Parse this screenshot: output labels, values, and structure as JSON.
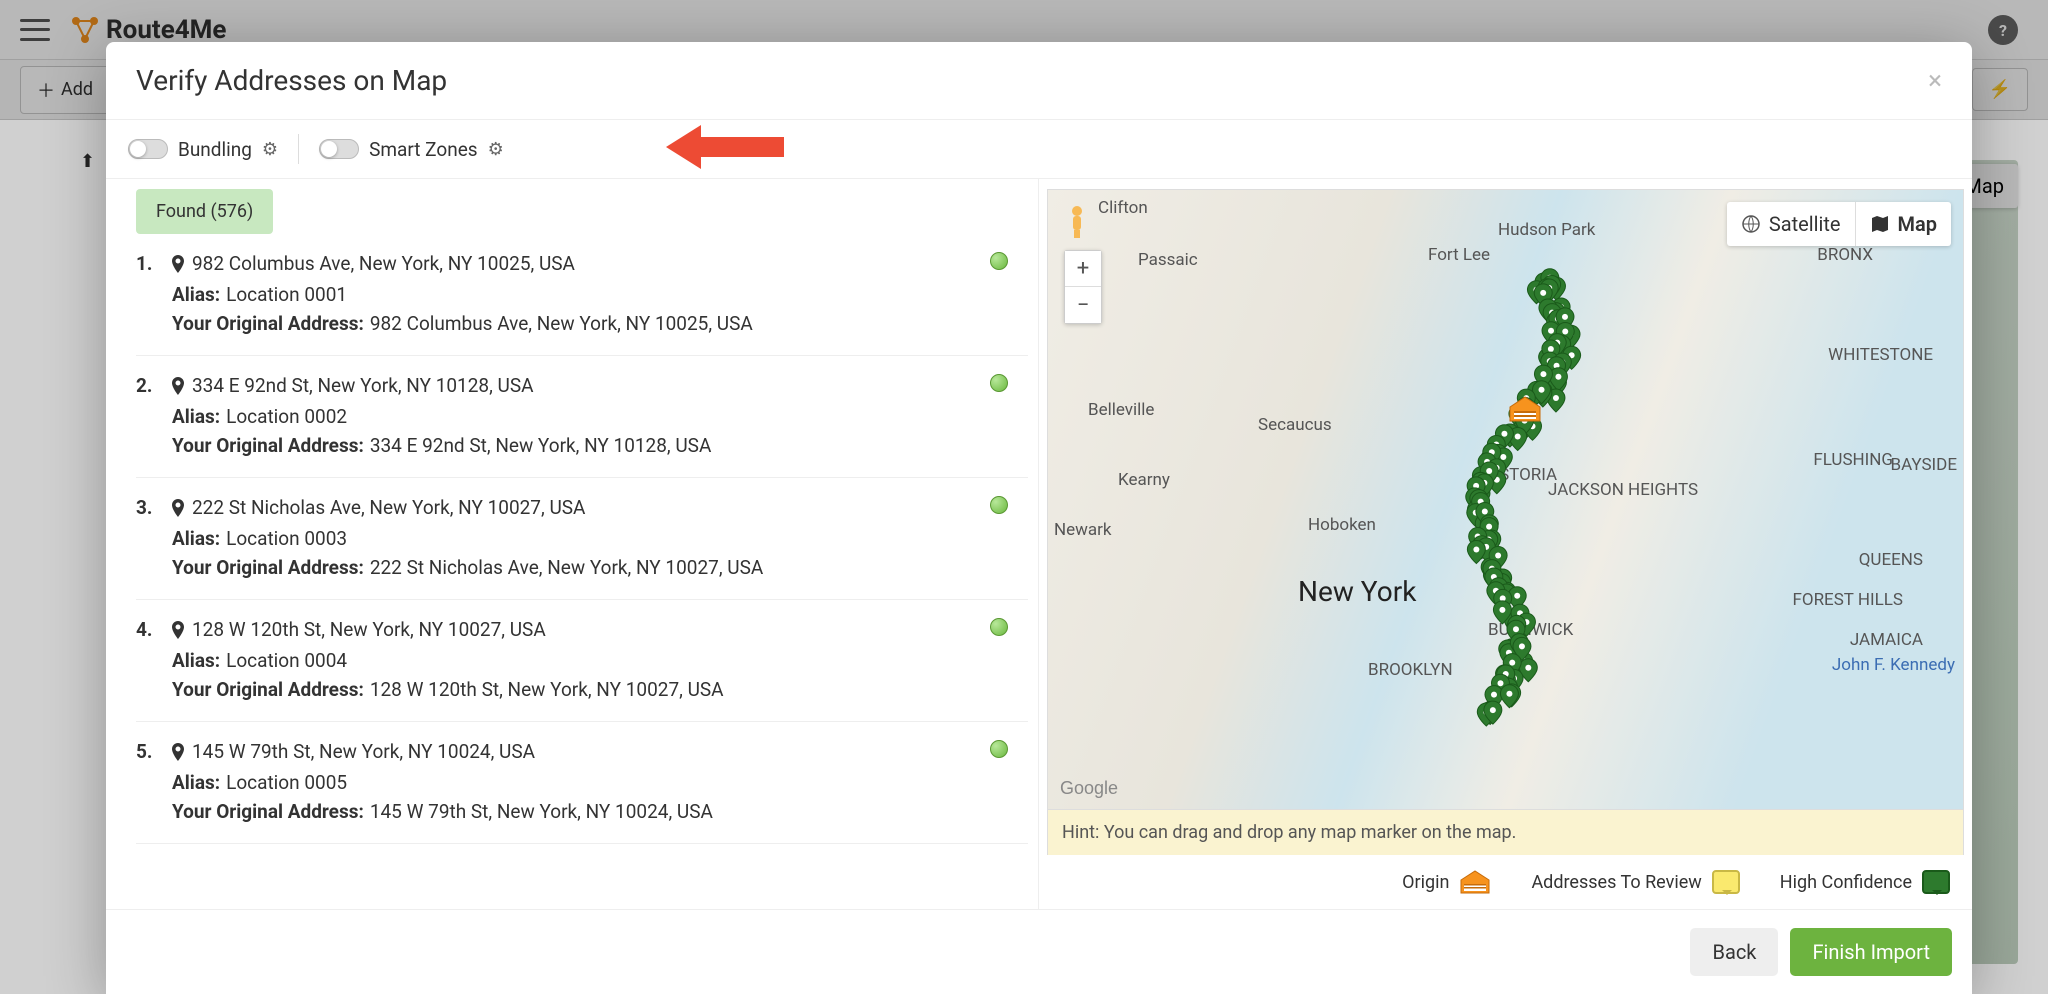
{
  "app": {
    "brand": "Route4Me",
    "add_button": "Add"
  },
  "bg_map_toggle": "Map",
  "modal": {
    "title": "Verify Addresses on Map",
    "toggles": {
      "bundling": "Bundling",
      "smart_zones": "Smart Zones"
    },
    "tab_found": "Found (576)",
    "hint": "Hint: You can drag and drop any map marker on the map.",
    "buttons": {
      "back": "Back",
      "finish": "Finish Import"
    }
  },
  "labels": {
    "alias": "Alias:",
    "original": "Your Original Address:"
  },
  "map": {
    "satellite": "Satellite",
    "map": "Map",
    "places": {
      "clifton": "Clifton",
      "passaic": "Passaic",
      "hudsonpark": "Hudson Park",
      "fortlee": "Fort Lee",
      "bronx": "BRONX",
      "belleville": "Belleville",
      "secaucus": "Secaucus",
      "whitestone": "WHITESTONE",
      "kearny": "Kearny",
      "astoria": "ASTORIA",
      "jacksonheights": "JACKSON HEIGHTS",
      "flushing": "FLUSHING",
      "bayside": "BAYSIDE",
      "hoboken": "Hoboken",
      "newark": "Newark",
      "newyork": "New York",
      "queens": "QUEENS",
      "foresthills": "FOREST HILLS",
      "jamaica": "JAMAICA",
      "bushwick": "BUSHWICK",
      "brooklyn": "BROOKLYN",
      "jfk": "John F. Kennedy"
    },
    "google": "Google"
  },
  "legend": {
    "origin": "Origin",
    "review": "Addresses To Review",
    "high": "High Confidence"
  },
  "addresses": [
    {
      "n": "1.",
      "addr": "982 Columbus Ave, New York, NY 10025, USA",
      "alias": "Location 0001",
      "orig": "982 Columbus Ave, New York, NY 10025, USA"
    },
    {
      "n": "2.",
      "addr": "334 E 92nd St, New York, NY 10128, USA",
      "alias": "Location 0002",
      "orig": "334 E 92nd St, New York, NY 10128, USA"
    },
    {
      "n": "3.",
      "addr": "222 St Nicholas Ave, New York, NY 10027, USA",
      "alias": "Location 0003",
      "orig": "222 St Nicholas Ave, New York, NY 10027, USA"
    },
    {
      "n": "4.",
      "addr": "128 W 120th St, New York, NY 10027, USA",
      "alias": "Location 0004",
      "orig": "128 W 120th St, New York, NY 10027, USA"
    },
    {
      "n": "5.",
      "addr": "145 W 79th St, New York, NY 10024, USA",
      "alias": "Location 0005",
      "orig": "145 W 79th St, New York, NY 10024, USA"
    }
  ]
}
